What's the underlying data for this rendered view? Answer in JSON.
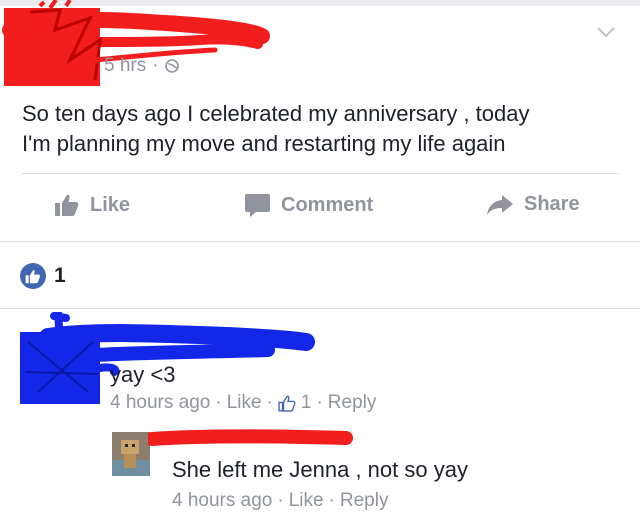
{
  "post": {
    "time": "5 hrs",
    "separator": "·",
    "text_line1": "So ten days ago I celebrated my anniversary , today",
    "text_line2": "I'm planning my move and restarting my life again"
  },
  "actions": {
    "like": "Like",
    "comment": "Comment",
    "share": "Share"
  },
  "likes": {
    "count": "1"
  },
  "comments": [
    {
      "text": "yay <3",
      "time": "4 hours ago",
      "sep": "·",
      "like": "Like",
      "like_count": "1",
      "reply": "Reply"
    },
    {
      "text": "She left me Jenna , not so yay",
      "time": "4 hours ago",
      "sep": "·",
      "like": "Like",
      "reply": "Reply"
    }
  ],
  "colors": {
    "facebook_blue": "#4267b2",
    "meta_gray": "#90949c",
    "redaction_red": "#ff1a1a",
    "redaction_blue": "#1427e8"
  },
  "icons": {
    "menu": "chevron-down-icon",
    "privacy": "globe-icon",
    "like": "thumbs-up-icon",
    "comment": "speech-bubble-icon",
    "share": "share-arrow-icon"
  }
}
